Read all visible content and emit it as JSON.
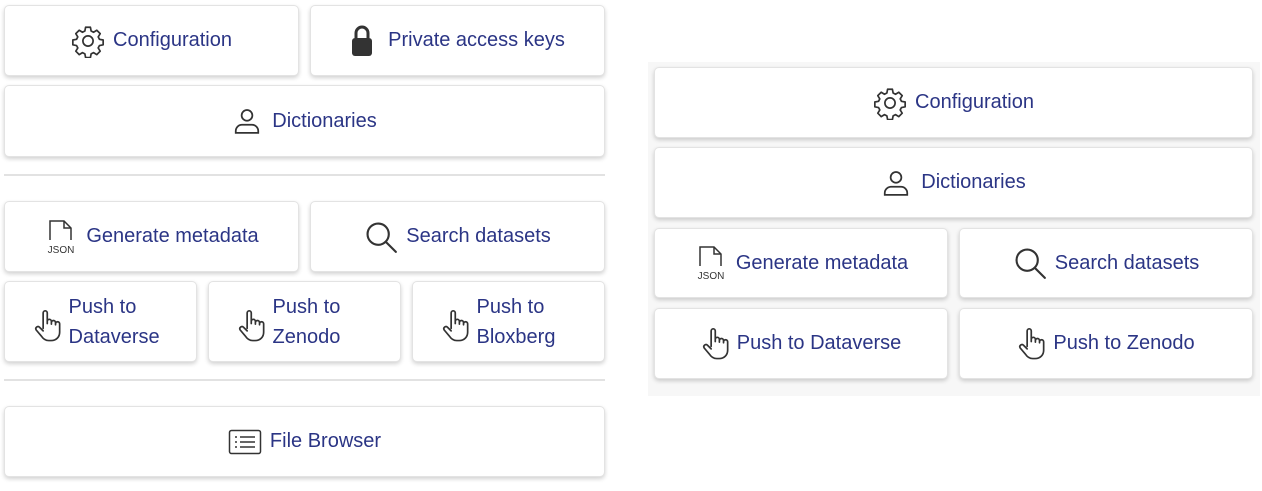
{
  "left_panel": {
    "configuration_label": "Configuration",
    "private_keys_label": "Private access keys",
    "dictionaries_label": "Dictionaries",
    "generate_metadata_label": "Generate metadata",
    "search_datasets_label": "Search datasets",
    "push_dataverse_label": "Push to Dataverse",
    "push_zenodo_label": "Push to Zenodo",
    "push_bloxberg_label": "Push to Bloxberg",
    "file_browser_label": "File Browser",
    "json_icon_text": "JSON"
  },
  "right_panel": {
    "configuration_label": "Configuration",
    "dictionaries_label": "Dictionaries",
    "generate_metadata_label": "Generate metadata",
    "search_datasets_label": "Search datasets",
    "push_dataverse_label": "Push to Dataverse",
    "push_zenodo_label": "Push to Zenodo",
    "json_icon_text": "JSON"
  },
  "icons": {
    "configuration": "gear-icon",
    "private_keys": "lock-icon",
    "dictionaries": "person-icon",
    "generate_metadata": "json-file-icon",
    "search_datasets": "magnifier-icon",
    "push": "pointing-hand-icon",
    "file_browser": "list-icon"
  },
  "colors": {
    "text": "#2b3585",
    "icon": "#333333",
    "button_bg": "#ffffff",
    "divider": "#e2e2e2",
    "right_panel_bg": "#f7f7f7"
  }
}
